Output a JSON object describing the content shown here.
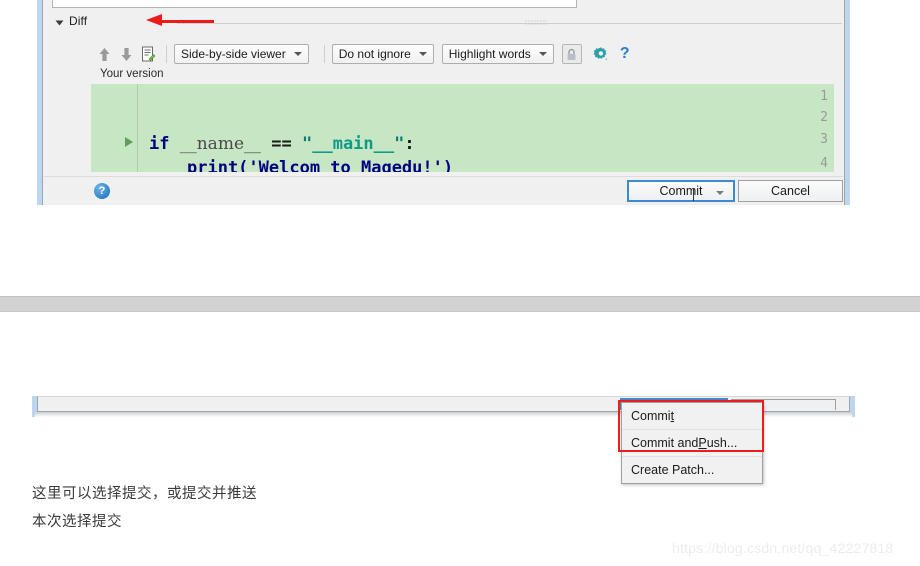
{
  "fragment1": {
    "diff_section": {
      "label": "Diff",
      "collapse_icon": "triangle-down-icon",
      "annotation_arrow": "red-left-arrow"
    },
    "toolbar": {
      "prev_icon": "arrow-up-icon",
      "next_icon": "arrow-down-icon",
      "edit_icon": "edit-diff-icon",
      "viewer_mode": "Side-by-side viewer",
      "ignore_mode": "Do not ignore",
      "highlight_mode": "Highlight words",
      "lock_icon": "lock-icon",
      "settings_icon": "gear-icon",
      "help_icon": "question-mark-icon"
    },
    "pane_label": "Your version",
    "code": {
      "lines": [
        {
          "num": "1",
          "text": "",
          "fold": false
        },
        {
          "num": "2",
          "text": "",
          "fold": false
        },
        {
          "num": "3",
          "text": "if __name__ == \"__main__\":",
          "fold": true
        },
        {
          "num": "4",
          "text": "print('Welcom to Magedu!')",
          "fold": false
        }
      ]
    },
    "buttons": {
      "help_label": "?",
      "commit_label": "Commit",
      "cancel_label": "Cancel"
    }
  },
  "fragment2": {
    "context_menu": {
      "items": [
        {
          "label": "Commit",
          "accel_before": "Commi",
          "accel": "t",
          "accel_after": ""
        },
        {
          "label": "Commit and Push...",
          "accel_before": "Commit and ",
          "accel": "P",
          "accel_after": "ush..."
        },
        {
          "label": "Create Patch...",
          "accel_before": "Create Patch...",
          "accel": "",
          "accel_after": ""
        }
      ]
    }
  },
  "annotations": {
    "line1": "这里可以选择提交，或提交并推送",
    "line2": "本次选择提交"
  },
  "watermark": "https://blog.csdn.net/qq_42227818",
  "colors": {
    "added_line_bg": "#c6e6c4",
    "focus_border": "#3a8bd1",
    "annotation_red": "#ee1c1c",
    "dialog_border": "#bcd6ef"
  }
}
